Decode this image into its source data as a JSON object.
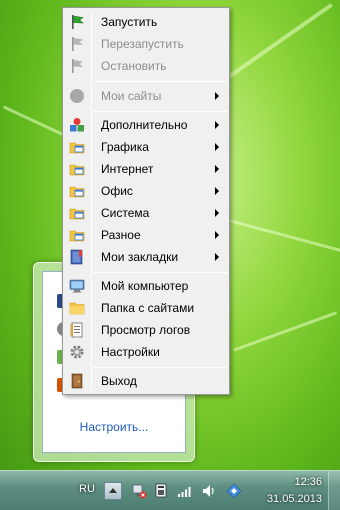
{
  "menu": {
    "items": [
      {
        "label": "Запустить",
        "icon": "green-flag-icon",
        "disabled": false
      },
      {
        "label": "Перезапустить",
        "icon": "gray-flag-icon",
        "disabled": true
      },
      {
        "label": "Остановить",
        "icon": "gray-flag-icon",
        "disabled": true
      },
      {
        "label": "Мои сайты",
        "icon": "gray-circle-icon",
        "disabled": true,
        "submenu": true
      },
      {
        "label": "Дополнительно",
        "icon": "colored-shapes-icon",
        "submenu": true
      },
      {
        "label": "Графика",
        "icon": "folder-window-icon",
        "submenu": true
      },
      {
        "label": "Интернет",
        "icon": "folder-window-icon",
        "submenu": true
      },
      {
        "label": "Офис",
        "icon": "folder-window-icon",
        "submenu": true
      },
      {
        "label": "Система",
        "icon": "folder-window-icon",
        "submenu": true
      },
      {
        "label": "Разное",
        "icon": "folder-window-icon",
        "submenu": true
      },
      {
        "label": "Мои закладки",
        "icon": "bookmarks-book-icon",
        "submenu": true
      },
      {
        "label": "Мой компьютер",
        "icon": "computer-icon"
      },
      {
        "label": "Папка с сайтами",
        "icon": "folder-icon"
      },
      {
        "label": "Просмотр логов",
        "icon": "log-document-icon"
      },
      {
        "label": "Настройки",
        "icon": "gear-icon"
      },
      {
        "label": "Выход",
        "icon": "exit-door-icon"
      }
    ]
  },
  "tray_popup": {
    "customize_label": "Настроить..."
  },
  "taskbar": {
    "language": "RU",
    "time": "12:36",
    "date": "31.05.2013"
  },
  "colors": {
    "menu_bg": "#f0f0f0",
    "link": "#1e5bb5",
    "desktop": "#8fd63c"
  }
}
